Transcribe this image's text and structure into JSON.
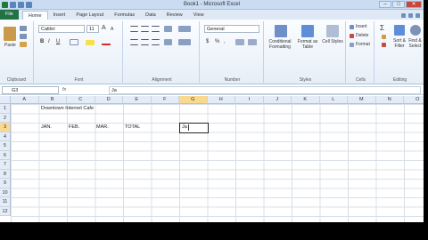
{
  "window": {
    "title": "Book1 - Microsoft Excel",
    "controls": [
      "–",
      "□",
      "✕"
    ]
  },
  "tabs": [
    "File",
    "Home",
    "Insert",
    "Page Layout",
    "Formulas",
    "Data",
    "Review",
    "View"
  ],
  "ribbon": {
    "clipboard": {
      "group_label": "Clipboard",
      "paste_label": "Paste"
    },
    "font": {
      "group_label": "Font",
      "font_name": "Calibri",
      "font_size": "11",
      "bold": "B",
      "italic": "I",
      "underline": "U",
      "grow": "A",
      "shrink": "A"
    },
    "alignment": {
      "group_label": "Alignment"
    },
    "number": {
      "group_label": "Number",
      "format": "General",
      "currency": "$",
      "percent": "%",
      "comma": ","
    },
    "styles": {
      "group_label": "Styles",
      "conditional": "Conditional Formatting",
      "format_table": "Format as Table",
      "cell_styles": "Cell Styles"
    },
    "cells": {
      "group_label": "Cells",
      "insert": "Insert",
      "delete": "Delete",
      "format": "Format"
    },
    "editing": {
      "group_label": "Editing",
      "sum": "Σ",
      "sort": "Sort & Filter",
      "find": "Find & Select"
    }
  },
  "formula_bar": {
    "name_box": "G3",
    "fx": "fx",
    "content": "Ja"
  },
  "columns": [
    "A",
    "B",
    "C",
    "D",
    "E",
    "F",
    "G",
    "H",
    "I",
    "J",
    "K",
    "L",
    "M",
    "N",
    "O"
  ],
  "rows": [
    "1",
    "2",
    "3",
    "4",
    "5",
    "6",
    "7",
    "8",
    "9",
    "10",
    "11",
    "12"
  ],
  "cells": {
    "B2": "Downtown Internet Cafe",
    "B3": "JAN.",
    "C3": "FEB.",
    "D3": "MAR.",
    "E3": "TOTAL",
    "G3": "Ja"
  },
  "selection": {
    "column": "G",
    "row": "3"
  },
  "colors": {
    "file_tab": "#217346",
    "header_selected": "#f9d98f",
    "ribbon_bg": "#e6eef8"
  }
}
